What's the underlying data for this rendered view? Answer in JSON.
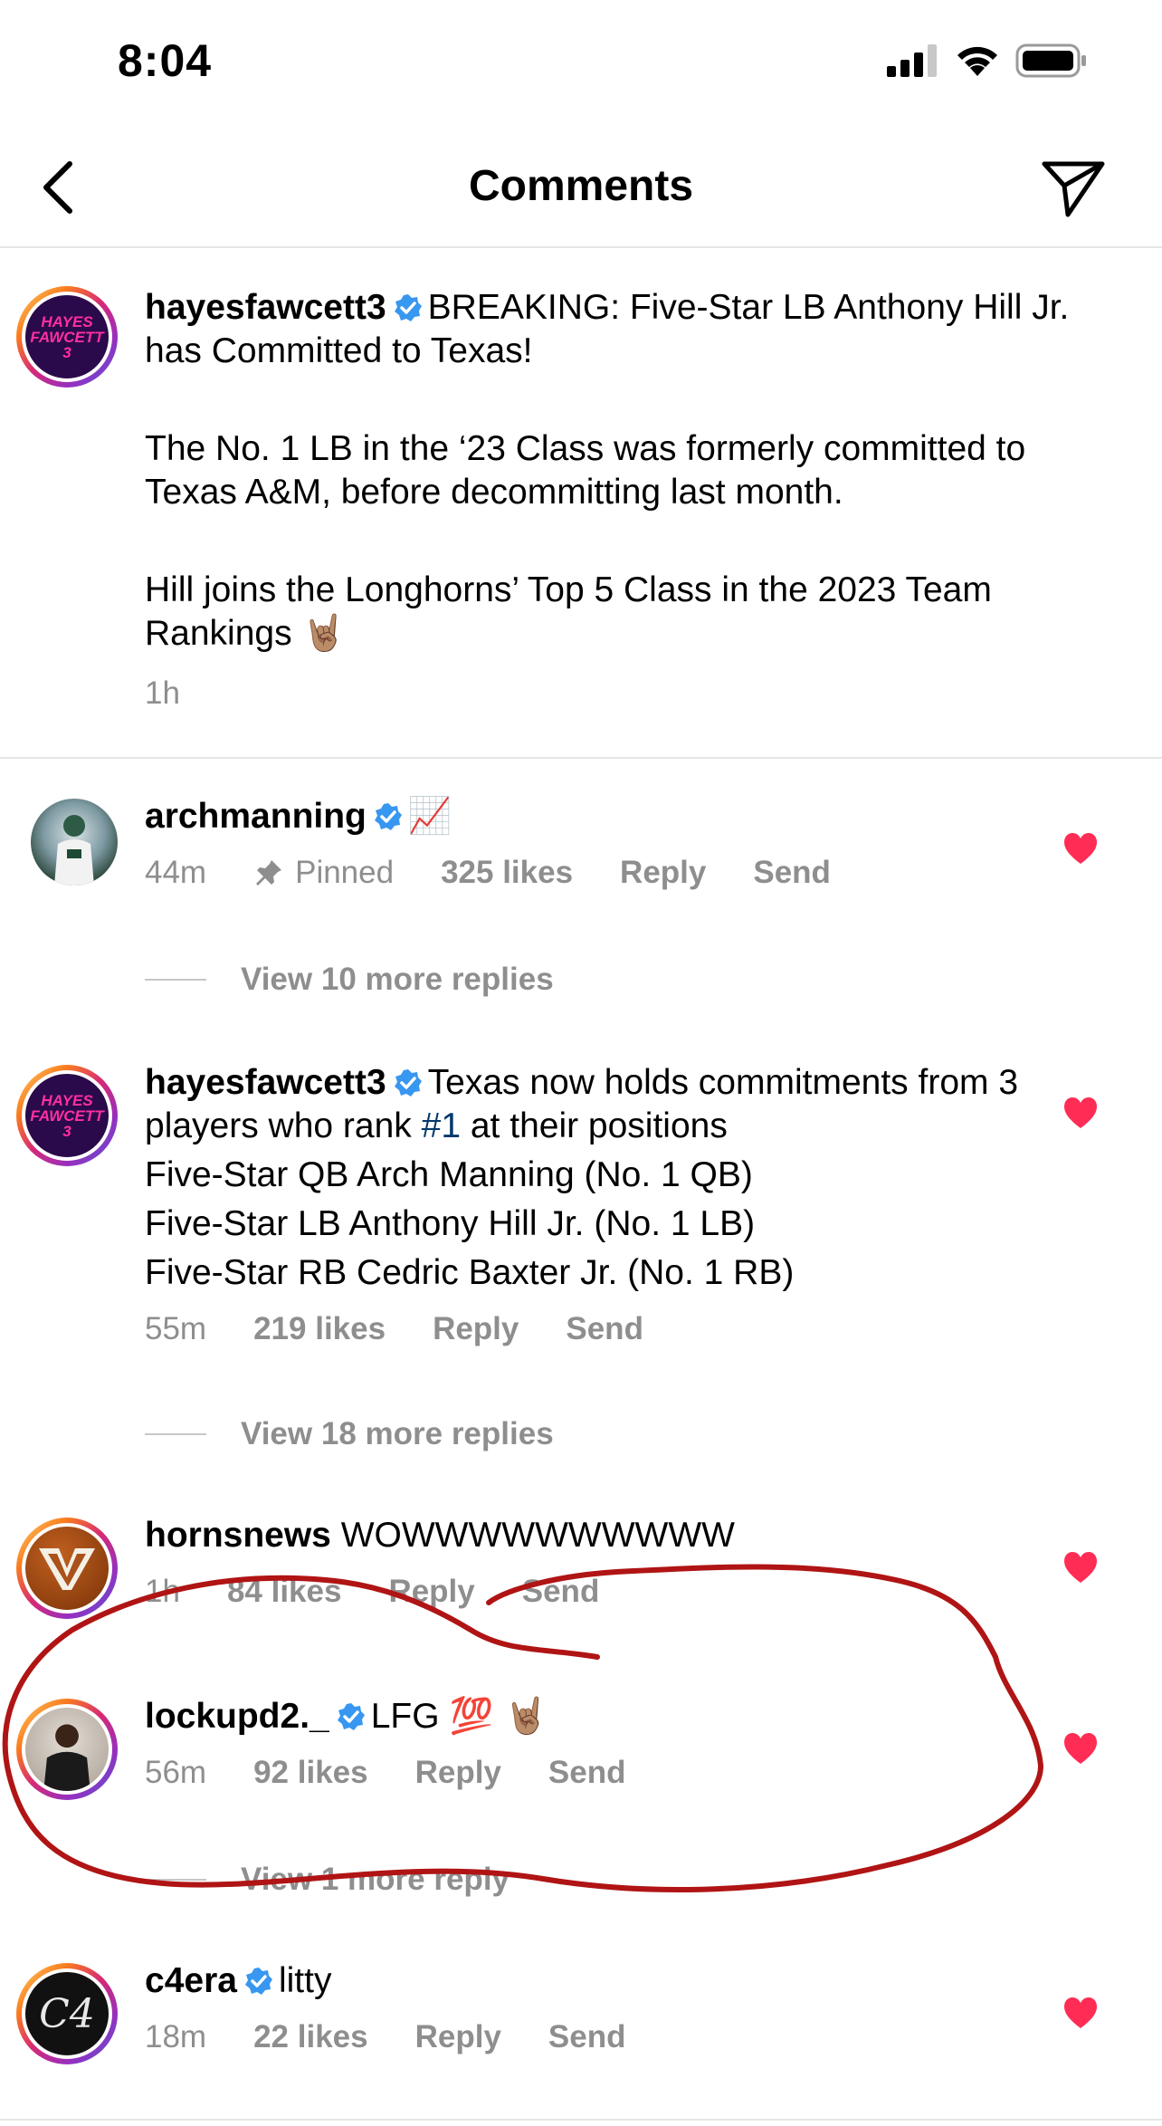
{
  "status_bar": {
    "time": "8:04"
  },
  "header": {
    "title": "Comments"
  },
  "caption": {
    "username": "hayesfawcett3",
    "avatar_text": "HAYES FAWCETT 3",
    "line1": "BREAKING: Five-Star LB Anthony Hill Jr. has Committed to Texas!",
    "line2": "The No. 1 LB in the ‘23 Class was formerly committed to Texas A&M, before decommitting last month.",
    "line3": "Hill joins the Longhorns’ Top 5 Class in the 2023 Team Rankings",
    "line3_emoji": "🤘🏽",
    "time": "1h"
  },
  "comments": [
    {
      "username": "archmanning",
      "verified": true,
      "text": "📈",
      "time": "44m",
      "pinned_label": "Pinned",
      "likes": "325 likes",
      "reply": "Reply",
      "send": "Send",
      "view_replies": "View 10 more replies"
    },
    {
      "username": "hayesfawcett3",
      "avatar_text": "HAYES FAWCETT 3",
      "verified": true,
      "text_pre": "Texas now holds commitments from 3 players who rank ",
      "hashtag": "#1",
      "text_post": " at their positions",
      "line2": "Five-Star QB Arch Manning (No. 1 QB)",
      "line3": "Five-Star LB Anthony Hill Jr. (No. 1 LB)",
      "line4": "Five-Star RB Cedric Baxter Jr. (No. 1 RB)",
      "time": "55m",
      "likes": "219 likes",
      "reply": "Reply",
      "send": "Send",
      "view_replies": "View 18 more replies"
    },
    {
      "username": "hornsnews",
      "verified": false,
      "text": "WOWWWWWWWWWW",
      "time": "1h",
      "likes": "84 likes",
      "reply": "Reply",
      "send": "Send"
    },
    {
      "username": "lockupd2._",
      "verified": true,
      "text": "LFG",
      "emoji": "💯 🤘🏽",
      "time": "56m",
      "likes": "92 likes",
      "reply": "Reply",
      "send": "Send",
      "view_replies": "View 1 more reply"
    },
    {
      "username": "c4era",
      "verified": true,
      "avatar_text": "C4",
      "text": "litty",
      "time": "18m",
      "likes": "22 likes",
      "reply": "Reply",
      "send": "Send"
    }
  ],
  "colors": {
    "heart": "#ff2d55",
    "verified": "#3897f0",
    "meta_text": "#8e8e8e",
    "annotation": "#b01414",
    "hashtag": "#00376b"
  },
  "icons": [
    "back-chevron-icon",
    "send-icon",
    "verified-icon",
    "pin-icon",
    "heart-icon",
    "signal-icon",
    "wifi-icon",
    "battery-icon"
  ]
}
